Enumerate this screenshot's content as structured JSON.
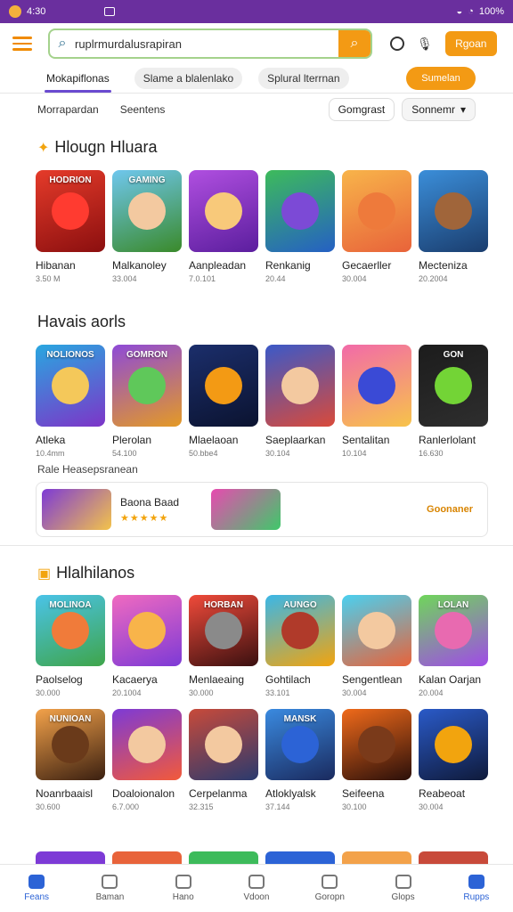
{
  "status": {
    "time": "4:30",
    "battery": "100%"
  },
  "search": {
    "value": "ruplrmurdalusrapiran"
  },
  "topbar": {
    "cta_label": "Rgoan"
  },
  "tabs": [
    {
      "label": "Mokapiflonas"
    },
    {
      "label": "Slame a blalenlako"
    },
    {
      "label": "Splural lterrnan"
    }
  ],
  "tabs_cta": "Sumelan",
  "filters": {
    "left1": "Morrapardan",
    "left2": "Seentens",
    "btn": "Gomgrast",
    "sort": "Sonnemr"
  },
  "section1": {
    "title": "Hlougn Hluara",
    "items": [
      {
        "label": "HODRION",
        "name": "Hibanan",
        "sub": "3.50 M",
        "c1": "#e53b2a",
        "c2": "#8b0f0f",
        "art": "#ff3b30"
      },
      {
        "label": "GAMING",
        "name": "Malkanoley",
        "sub": "33.004",
        "c1": "#6fc7ee",
        "c2": "#3a8a2a",
        "art": "#f3c9a0"
      },
      {
        "label": "",
        "name": "Aanpleadan",
        "sub": "7.0.101",
        "c1": "#b04fe0",
        "c2": "#5b1e9e",
        "art": "#f8c97a"
      },
      {
        "label": "",
        "name": "Renkanig",
        "sub": "20.44",
        "c1": "#3dbb5b",
        "c2": "#2560c4",
        "art": "#7c4ad6"
      },
      {
        "label": "",
        "name": "Gecaerller",
        "sub": "30.004",
        "c1": "#f8b44a",
        "c2": "#e8633a",
        "art": "#ee7a3b"
      },
      {
        "label": "",
        "name": "Mecteniza",
        "sub": "20.2004",
        "c1": "#3b8ed9",
        "c2": "#1a3d6e",
        "art": "#a0653a"
      }
    ]
  },
  "section2": {
    "title": "Havais aorls",
    "items": [
      {
        "label": "NOLIONOS",
        "name": "Atleka",
        "sub": "10.4mm",
        "c1": "#29a7e0",
        "c2": "#7d35c8",
        "art": "#f4c85a"
      },
      {
        "label": "GOMRON",
        "name": "Plerolan",
        "sub": "54.100",
        "c1": "#8e4ad8",
        "c2": "#e49a25",
        "art": "#5fc85a"
      },
      {
        "label": "",
        "name": "Mlaelaoan",
        "sub": "50.bbe4",
        "c1": "#1b2e6b",
        "c2": "#0b1330",
        "art": "#f39a14"
      },
      {
        "label": "",
        "name": "Saeplaarkan",
        "sub": "30.104",
        "c1": "#3b59c8",
        "c2": "#d94a3a",
        "art": "#f3c9a0"
      },
      {
        "label": "",
        "name": "Sentalitan",
        "sub": "10.104",
        "c1": "#f26aa9",
        "c2": "#f7c34a",
        "art": "#3a4ad6"
      },
      {
        "label": "GON",
        "name": "Ranlerlolant",
        "sub": "16.630",
        "c1": "#1c1c1c",
        "c2": "#2e2e2e",
        "art": "#73d436"
      }
    ]
  },
  "featured": {
    "caption": "Rale Heasepsranean",
    "title": "Baona Baad",
    "stars": "★★★★★",
    "link": "Goonaner"
  },
  "section3": {
    "title": "Hlalhilanos",
    "items": [
      {
        "label": "MOLINOA",
        "name": "Paolselog",
        "sub": "30.000",
        "c1": "#4ac3e8",
        "c2": "#3fa54a",
        "art": "#f07b3a"
      },
      {
        "label": "",
        "name": "Kacaerya",
        "sub": "20.1004",
        "c1": "#f06ac0",
        "c2": "#7d3ad6",
        "art": "#f8b44a"
      },
      {
        "label": "HORBAN",
        "name": "Menlaeaing",
        "sub": "30.000",
        "c1": "#f04a3a",
        "c2": "#3a1010",
        "art": "#8a8a8a"
      },
      {
        "label": "AUNGO",
        "name": "Gohtilach",
        "sub": "33.101",
        "c1": "#3ab7e8",
        "c2": "#f2a40e",
        "art": "#b03a2a"
      },
      {
        "label": "",
        "name": "Sengentlean",
        "sub": "30.004",
        "c1": "#4ad0f0",
        "c2": "#e8633a",
        "art": "#f3c9a0"
      },
      {
        "label": "LOLAN",
        "name": "Kalan Oarjan",
        "sub": "20.004",
        "c1": "#6fd65a",
        "c2": "#a04ae8",
        "art": "#e86ab0"
      }
    ]
  },
  "section4": {
    "items": [
      {
        "label": "NUNIOAN",
        "name": "Noanrbaaisl",
        "sub": "30.600",
        "c1": "#f3a24a",
        "c2": "#3a1f10",
        "art": "#6a3a1a"
      },
      {
        "label": "",
        "name": "Doaloionalon",
        "sub": "6.7.000",
        "c1": "#7d3ad6",
        "c2": "#f25a3a",
        "art": "#f3c9a0"
      },
      {
        "label": "",
        "name": "Cerpelanma",
        "sub": "32.315",
        "c1": "#c84a3a",
        "c2": "#2a3a6e",
        "art": "#f3c9a0"
      },
      {
        "label": "MANSK",
        "name": "Atloklyalsk",
        "sub": "37.144",
        "c1": "#3a8ae0",
        "c2": "#1a2a5e",
        "art": "#2c63d6"
      },
      {
        "label": "",
        "name": "Seifeena",
        "sub": "30.100",
        "c1": "#f06a1a",
        "c2": "#2a0f0a",
        "art": "#7a3a1a"
      },
      {
        "label": "",
        "name": "Reabeoat",
        "sub": "30.004",
        "c1": "#2a5ac8",
        "c2": "#0f1a3a",
        "art": "#f2a40e"
      }
    ]
  },
  "bottom_nav": [
    {
      "label": "Feans"
    },
    {
      "label": "Baman"
    },
    {
      "label": "Hano"
    },
    {
      "label": "Vdoon"
    },
    {
      "label": "Goropn"
    },
    {
      "label": "Glops"
    },
    {
      "label": "Rupps"
    }
  ]
}
